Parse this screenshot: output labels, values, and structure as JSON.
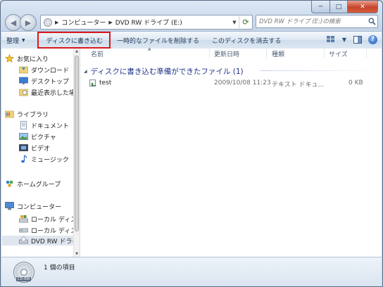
{
  "window": {
    "controls": {
      "minimize": "─",
      "maximize": "□",
      "close": "✕"
    }
  },
  "address_bar": {
    "crumbs": [
      "コンピューター",
      "DVD RW ドライブ (E:)"
    ]
  },
  "search": {
    "placeholder": "DVD RW ドライブ (E:)の検索"
  },
  "toolbar": {
    "organize": "整理",
    "burn": "ディスクに書き込む",
    "delete_temp": "一時的なファイルを削除する",
    "erase_disc": "このディスクを消去する"
  },
  "nav_pane": {
    "favorites": "お気に入り",
    "downloads": "ダウンロード",
    "desktop": "デスクトップ",
    "recent": "最近表示した場所",
    "libraries": "ライブラリ",
    "documents": "ドキュメント",
    "pictures": "ピクチャ",
    "videos": "ビデオ",
    "music": "ミュージック",
    "homegroup": "ホームグループ",
    "computer": "コンピューター",
    "local_disk_1": "ローカル ディスク",
    "local_disk_2": "ローカル ディスク",
    "dvd_drive": "DVD RW ドライブ"
  },
  "columns": {
    "name": "名前",
    "modified": "更新日時",
    "type": "種類",
    "size": "サイズ"
  },
  "group": {
    "title": "ディスクに書き込む準備ができたファイル (1)"
  },
  "files": [
    {
      "name": "test",
      "modified": "2009/10/08 11:23",
      "type": "テキスト ドキュ...",
      "size": "0 KB"
    }
  ],
  "details": {
    "count": "1 個の項目",
    "disc_label": "CD-RW"
  }
}
